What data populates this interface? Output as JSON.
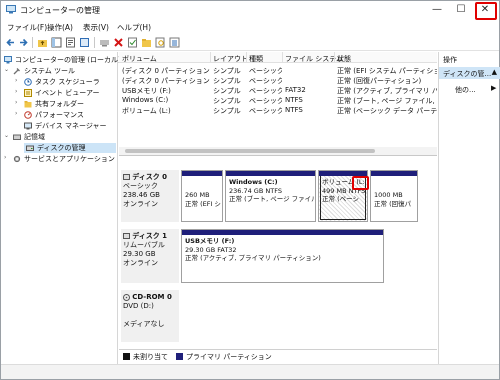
{
  "window": {
    "title": "コンピューターの管理",
    "minimize_glyph": "—",
    "maximize_glyph": "☐",
    "close_glyph": "✕"
  },
  "menu": {
    "items": [
      "ファイル(F)",
      "操作(A)",
      "表示(V)",
      "ヘルプ(H)"
    ]
  },
  "tree": {
    "root": "コンピューターの管理 (ローカル)",
    "system_tools": "システム ツール",
    "task_scheduler": "タスク スケジューラ",
    "event_viewer": "イベント ビューアー",
    "shared_folders": "共有フォルダー",
    "performance": "パフォーマンス",
    "device_manager": "デバイス マネージャー",
    "storage": "記憶域",
    "disk_management": "ディスクの管理",
    "services": "サービスとアプリケーション"
  },
  "volume_list": {
    "columns": [
      "ボリューム",
      "レイアウト",
      "種類",
      "ファイル システム",
      "状態"
    ],
    "rows": [
      [
        "(ディスク 0 パーティション 1)",
        "シンプル",
        "ベーシック",
        "",
        "正常 (EFI システム パーティション)"
      ],
      [
        "(ディスク 0 パーティション 4)",
        "シンプル",
        "ベーシック",
        "",
        "正常 (回復パーティション)"
      ],
      [
        "USBメモリ (F:)",
        "シンプル",
        "ベーシック",
        "FAT32",
        "正常 (アクティブ, プライマリ パーティ"
      ],
      [
        "Windows (C:)",
        "シンプル",
        "ベーシック",
        "NTFS",
        "正常 (ブート, ページ ファイル, クラ"
      ],
      [
        "ボリューム (L:)",
        "シンプル",
        "ベーシック",
        "NTFS",
        "正常 (ベーシック データ パーティシ"
      ]
    ]
  },
  "disks": [
    {
      "name": "ディスク 0",
      "type": "ベーシック",
      "size": "238.46 GB",
      "status": "オンライン",
      "partitions": [
        {
          "title": "",
          "size": "260 MB",
          "detail": "正常 (EFI シ"
        },
        {
          "title": "Windows (C:)",
          "size": "236.74 GB NTFS",
          "detail": "正常 (ブート, ページ ファイル, ク"
        },
        {
          "title": "ボリューム (L:",
          "size": "499 MB NTFS",
          "detail": "正常 (ベーシ"
        },
        {
          "title": "",
          "size": "1000 MB",
          "detail": "正常 (回復パ"
        }
      ]
    },
    {
      "name": "ディスク 1",
      "type": "リムーバブル",
      "size": "29.30 GB",
      "status": "オンライン",
      "partitions": [
        {
          "title": "USBメモリ (F:)",
          "size": "29.30 GB FAT32",
          "detail": "正常 (アクティブ, プライマリ パーティション)"
        }
      ]
    },
    {
      "name": "CD-ROM 0",
      "type": "DVD (D:)",
      "size": "",
      "status": "メディアなし",
      "partitions": []
    }
  ],
  "legend": {
    "unallocated": "未割り当て",
    "primary": "プライマリ パーティション",
    "unallocated_color": "#111111",
    "primary_color": "#1f1f7a"
  },
  "operations": {
    "header": "操作",
    "selected": "ディスクの管...",
    "other": "他の...",
    "up_glyph": "▲",
    "arrow_glyph": "▶"
  },
  "colors": {
    "partition_bar": "#1f1f7a",
    "highlight": "#e00000",
    "selection": "#cce4f7"
  }
}
